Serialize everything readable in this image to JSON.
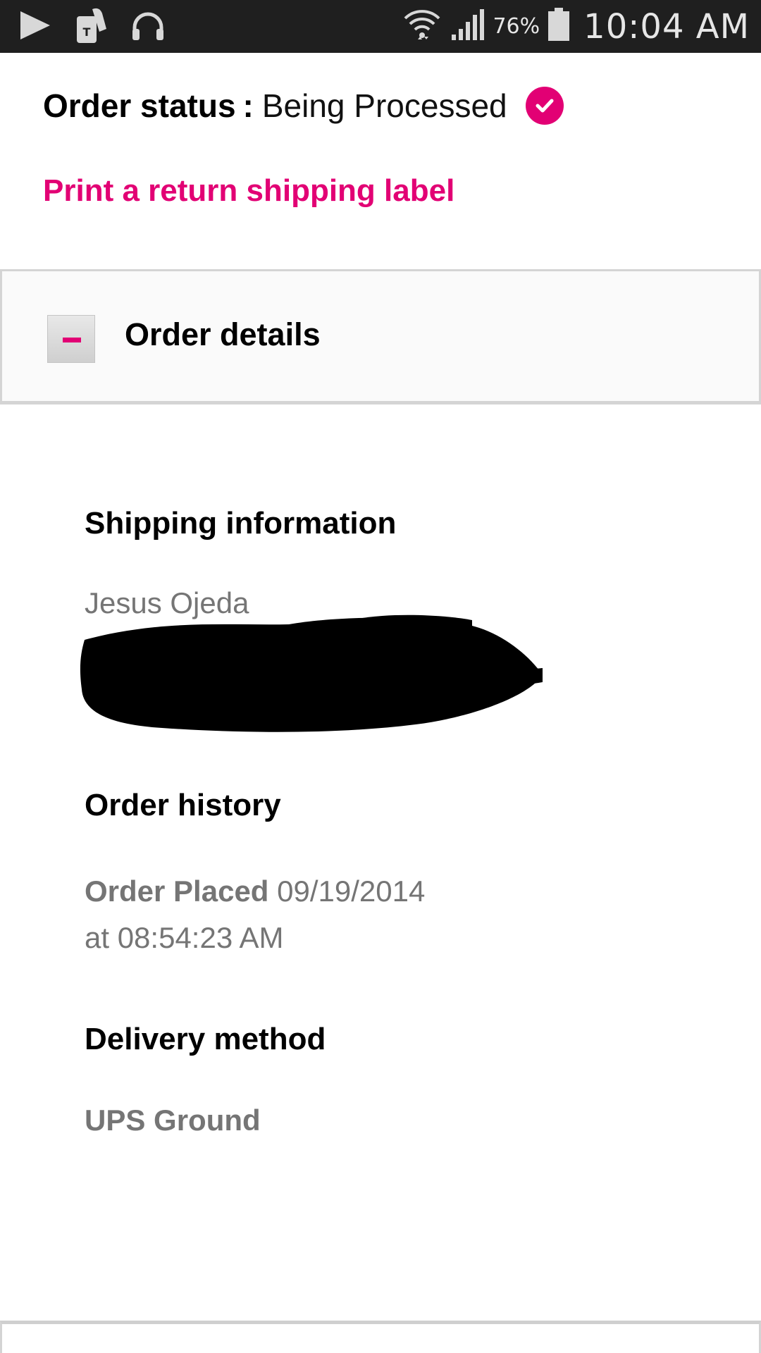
{
  "status_bar": {
    "battery_percent": "76%",
    "time": "10:04 AM",
    "icons": [
      "play-store-icon",
      "tmobile-app-icon",
      "headphones-icon",
      "wifi-icon",
      "signal-icon",
      "battery-icon"
    ]
  },
  "order_status": {
    "label": "Order status",
    "separator": ":",
    "value": "Being Processed",
    "badge_icon": "checkmark-icon"
  },
  "return_link": "Print a return shipping label",
  "order_details": {
    "toggle_icon": "minus-icon",
    "title": "Order details",
    "shipping": {
      "heading": "Shipping information",
      "name": "Jesus Ojeda"
    },
    "history": {
      "heading": "Order history",
      "event_label": "Order Placed",
      "event_date": "09/19/2014",
      "event_time": "at 08:54:23 AM"
    },
    "delivery": {
      "heading": "Delivery method",
      "method": "UPS Ground"
    }
  },
  "colors": {
    "accent": "#e20074",
    "status_bar_bg": "#1f1f1f",
    "secondary_text": "#757575"
  }
}
